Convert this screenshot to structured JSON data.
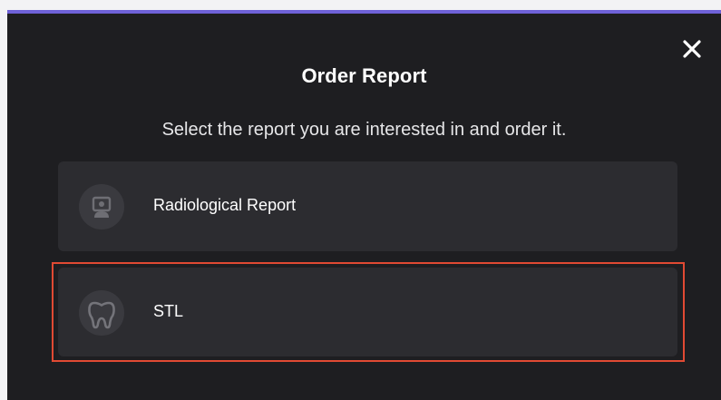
{
  "modal": {
    "title": "Order Report",
    "subtitle": "Select the report you are interested in and order it.",
    "close_icon": "close-icon"
  },
  "options": [
    {
      "label": "Radiological Report",
      "icon": "radiology-viewer-icon"
    },
    {
      "label": "STL",
      "icon": "tooth-icon"
    }
  ],
  "colors": {
    "accent": "#6f62d8",
    "background": "#1e1e21",
    "card": "#2c2c30",
    "highlight": "#e14a33"
  }
}
